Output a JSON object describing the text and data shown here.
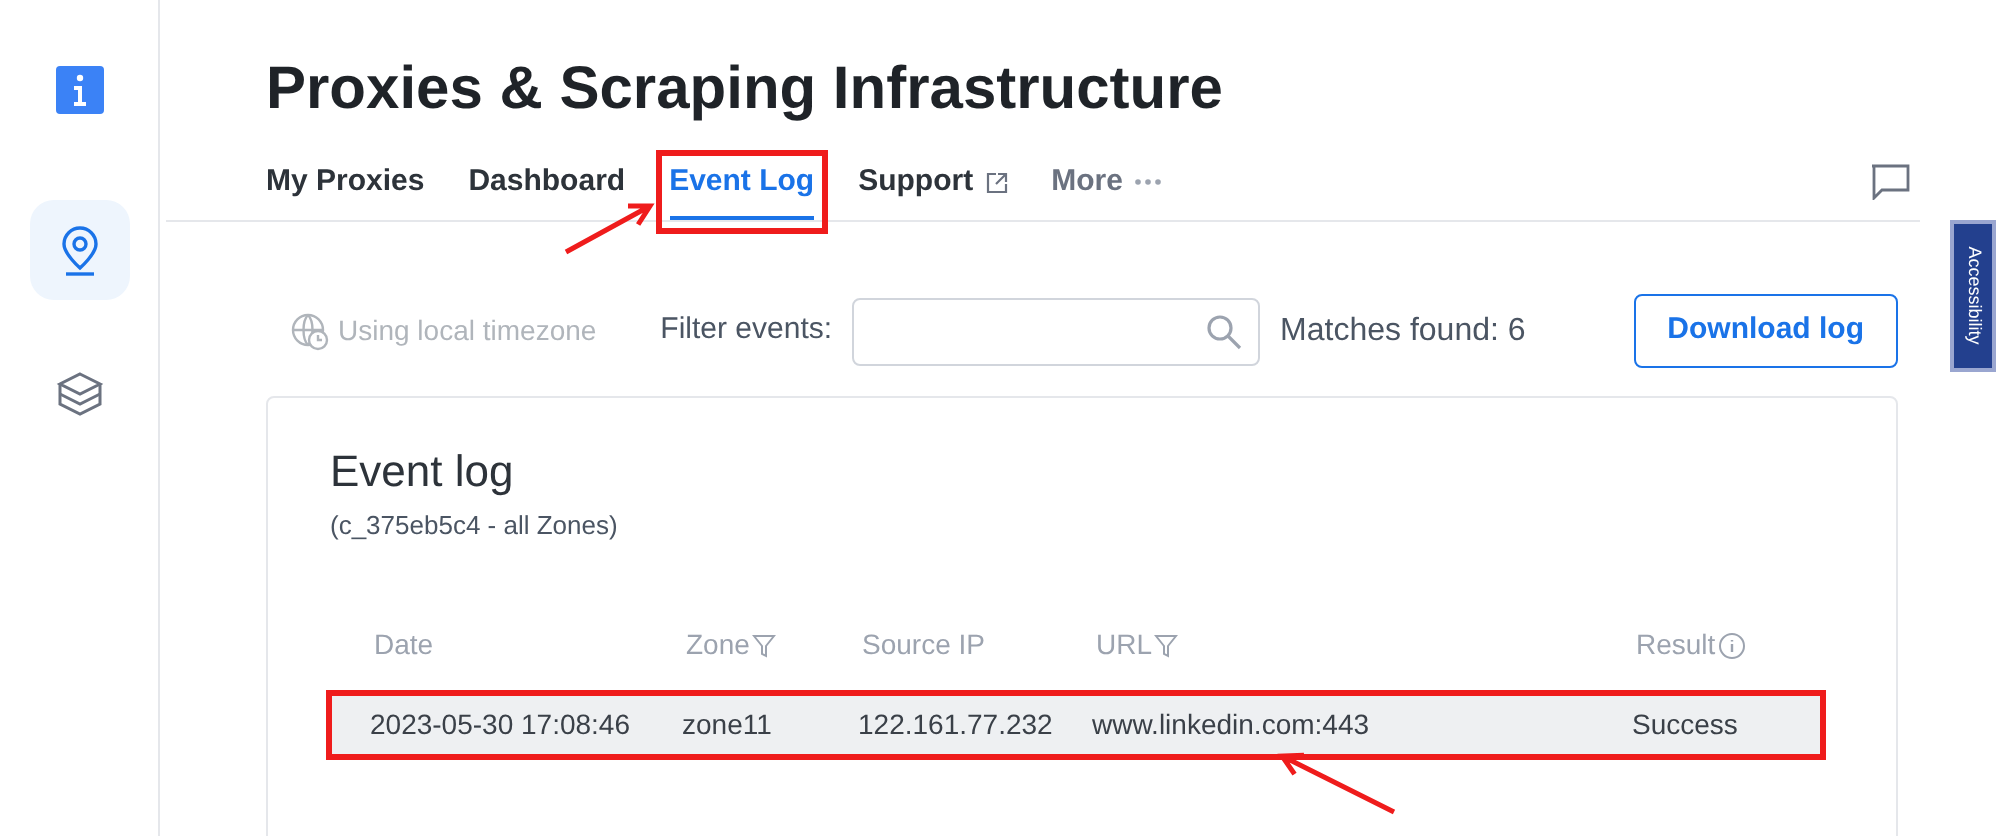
{
  "page": {
    "title": "Proxies & Scraping Infrastructure"
  },
  "sidebar": {
    "items": [
      {
        "kind": "info",
        "selected": false
      },
      {
        "kind": "pin",
        "selected": true
      },
      {
        "kind": "layers",
        "selected": false
      }
    ]
  },
  "tabs": [
    {
      "label": "My Proxies",
      "selected": false,
      "highlighted": false,
      "kind": "plain"
    },
    {
      "label": "Dashboard",
      "selected": false,
      "highlighted": false,
      "kind": "plain"
    },
    {
      "label": "Event Log",
      "selected": true,
      "highlighted": true,
      "kind": "plain"
    },
    {
      "label": "Support",
      "selected": false,
      "highlighted": false,
      "kind": "external"
    },
    {
      "label": "More",
      "selected": false,
      "highlighted": false,
      "kind": "more"
    }
  ],
  "accessibility_tab": "Accessibility",
  "toolbar": {
    "timezone": "Using local timezone",
    "filter_label": "Filter events:",
    "matches": "Matches found: 6",
    "download_button": "Download log"
  },
  "event_log": {
    "title": "Event log",
    "subtitle": "(c_375eb5c4 - all Zones)",
    "columns": [
      {
        "label": "Date",
        "kind": "plain"
      },
      {
        "label": "Zone",
        "kind": "filter"
      },
      {
        "label": "Source IP",
        "kind": "plain"
      },
      {
        "label": "URL",
        "kind": "filter"
      },
      {
        "label": "Result",
        "kind": "info"
      }
    ],
    "rows": [
      {
        "cells": [
          "2023-05-30 17:08:46",
          "zone11",
          "122.161.77.232",
          "www.linkedin.com:443",
          "Success"
        ],
        "highlighted": true
      }
    ]
  }
}
